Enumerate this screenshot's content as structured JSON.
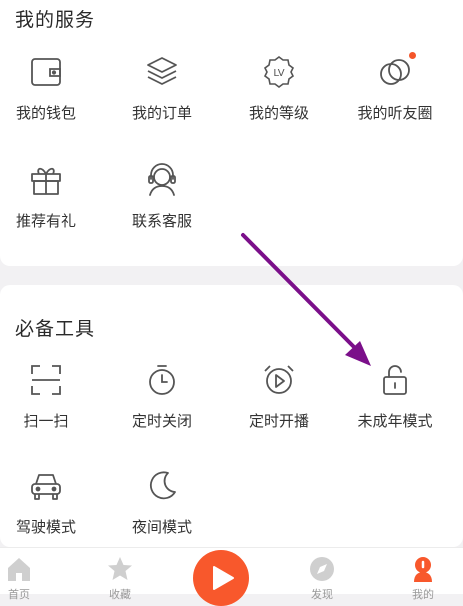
{
  "services": {
    "title": "我的服务",
    "items": [
      {
        "label": "我的钱包",
        "icon": "wallet-icon"
      },
      {
        "label": "我的订单",
        "icon": "layers-icon"
      },
      {
        "label": "我的等级",
        "icon": "lv-badge-icon"
      },
      {
        "label": "我的听友圈",
        "icon": "circles-icon"
      },
      {
        "label": "推荐有礼",
        "icon": "gift-icon"
      },
      {
        "label": "联系客服",
        "icon": "headset-icon"
      }
    ]
  },
  "tools": {
    "title": "必备工具",
    "items": [
      {
        "label": "扫一扫",
        "icon": "scan-icon"
      },
      {
        "label": "定时关闭",
        "icon": "timer-icon"
      },
      {
        "label": "定时开播",
        "icon": "alarm-play-icon"
      },
      {
        "label": "未成年模式",
        "icon": "lock-icon"
      },
      {
        "label": "驾驶模式",
        "icon": "car-icon"
      },
      {
        "label": "夜间模式",
        "icon": "moon-icon"
      }
    ]
  },
  "tabbar": {
    "tabs": [
      {
        "label": "首页",
        "icon": "home-icon"
      },
      {
        "label": "收藏",
        "icon": "star-icon"
      },
      {
        "label": "播放",
        "icon": "play-icon"
      },
      {
        "label": "发现",
        "icon": "compass-icon"
      },
      {
        "label": "我的",
        "icon": "profile-icon"
      }
    ]
  },
  "annotation": {
    "icon": "arrow-icon",
    "color": "#7b0f8a"
  },
  "colors": {
    "accent": "#f8582c",
    "icon_stroke": "#555555",
    "background": "#f2f1f3"
  }
}
